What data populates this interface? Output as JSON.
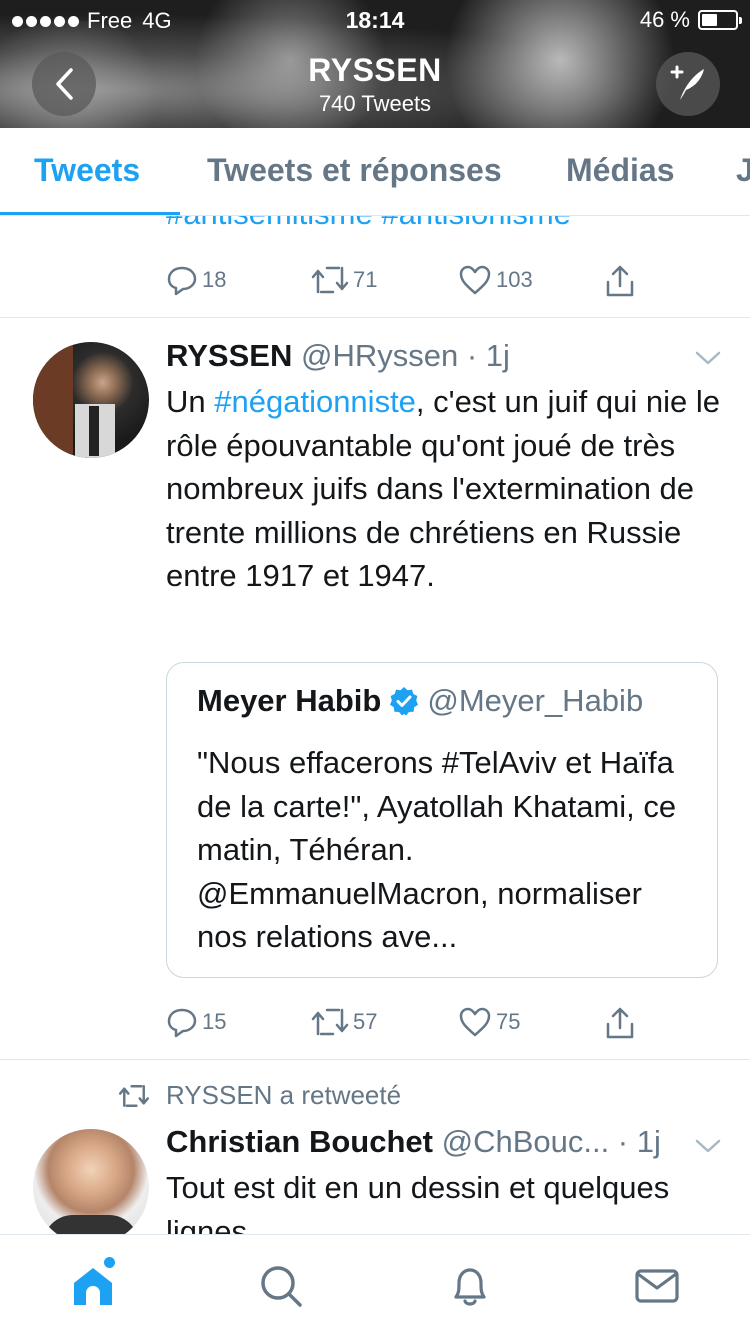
{
  "status_bar": {
    "carrier": "Free",
    "network": "4G",
    "time": "18:14",
    "battery_text": "46 %",
    "battery_level": 0.46
  },
  "profile": {
    "name": "RYSSEN",
    "tweet_count": "740 Tweets"
  },
  "tabs": [
    {
      "label": "Tweets",
      "active": true
    },
    {
      "label": "Tweets et réponses",
      "active": false
    },
    {
      "label": "Médias",
      "active": false
    },
    {
      "label": "J",
      "active": false
    }
  ],
  "previous_tweet": {
    "hashtags_text": "#antisemitisme #antisionisme",
    "replies": "18",
    "retweets": "71",
    "likes": "103"
  },
  "tweet1": {
    "name": "RYSSEN",
    "handle": "@HRyssen",
    "time": "1j",
    "text_prefix": "Un ",
    "hashtag": "#négationniste",
    "text_suffix": ", c'est un juif qui nie le rôle épouvantable qu'ont joué de très nombreux juifs dans l'extermination de trente millions de chrétiens en Russie entre 1917 et 1947.",
    "quote": {
      "name": "Meyer Habib",
      "handle": "@Meyer_Habib",
      "text": "\"Nous effacerons #TelAviv et Haïfa de la carte!\", Ayatollah Khatami, ce matin, Téhéran. @EmmanuelMacron, normaliser nos relations ave..."
    },
    "replies": "15",
    "retweets": "57",
    "likes": "75"
  },
  "tweet2": {
    "retweeted_by": "RYSSEN a retweeté",
    "name": "Christian Bouchet",
    "handle": "@ChBouc...",
    "time": "1j",
    "text": "Tout est dit en un dessin et quelques lignes"
  },
  "colors": {
    "accent": "#1da1f2",
    "secondary_text": "#657786",
    "border": "#e1e8ed"
  },
  "icons": [
    "back-icon",
    "compose-icon",
    "reply-icon",
    "retweet-icon",
    "like-icon",
    "share-icon",
    "chevron-down-icon",
    "verified-icon",
    "home-icon",
    "search-icon",
    "notifications-icon",
    "messages-icon"
  ]
}
